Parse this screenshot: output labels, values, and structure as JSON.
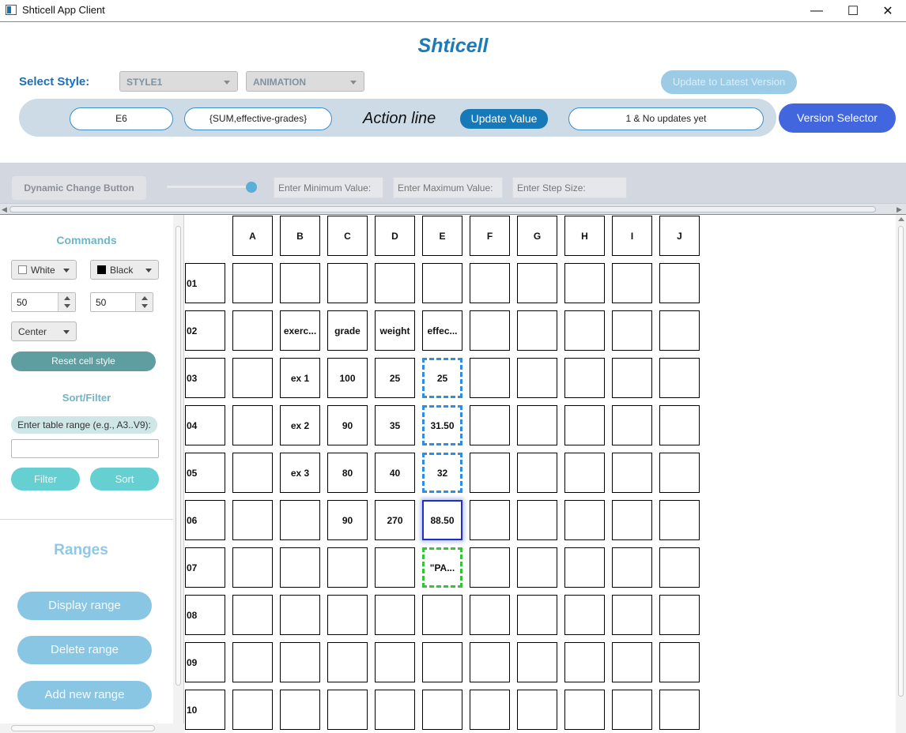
{
  "window": {
    "title": "Shticell App Client",
    "minimize_glyph": "—",
    "maximize_glyph": "☐",
    "close_glyph": "✕"
  },
  "header": {
    "brand": "Shticell",
    "select_style_label": "Select Style:",
    "style_combo": "STYLE1",
    "animation_combo": "ANIMATION",
    "update_latest_label": "Update to Latest Version"
  },
  "action_bar": {
    "cell_id": "E6",
    "original_value": "{SUM,effective-grades}",
    "label": "Action line",
    "update_value_label": "Update Value",
    "version_info": "1 & No updates yet",
    "version_selector_label": "Version Selector"
  },
  "dynamic": {
    "button_label": "Dynamic Change Button",
    "min_placeholder": "Enter Minimum Value:",
    "max_placeholder": "Enter Maximum Value:",
    "step_placeholder": "Enter Step Size:"
  },
  "commands": {
    "title": "Commands",
    "bg_color_label": "White",
    "text_color_label": "Black",
    "width_value": "50",
    "height_value": "50",
    "alignment_label": "Center",
    "reset_label": "Reset cell style"
  },
  "sort_filter": {
    "title": "Sort/Filter",
    "range_prompt": "Enter table range (e.g., A3..V9):",
    "range_value": "",
    "filter_label": "Filter",
    "sort_label": "Sort"
  },
  "ranges": {
    "title": "Ranges",
    "display_label": "Display range",
    "delete_label": "Delete range",
    "add_label": "Add new range"
  },
  "grid": {
    "columns": [
      "A",
      "B",
      "C",
      "D",
      "E",
      "F",
      "G",
      "H",
      "I",
      "J"
    ],
    "rows": [
      {
        "label": "01",
        "cells": [
          "",
          "",
          "",
          "",
          "",
          "",
          "",
          "",
          "",
          ""
        ]
      },
      {
        "label": "02",
        "cells": [
          "",
          "exerc...",
          "grade",
          "weight",
          "effec...",
          "",
          "",
          "",
          "",
          ""
        ]
      },
      {
        "label": "03",
        "cells": [
          "",
          "ex 1",
          "100",
          "25",
          "25",
          "",
          "",
          "",
          "",
          ""
        ]
      },
      {
        "label": "04",
        "cells": [
          "",
          "ex 2",
          "90",
          "35",
          "31.50",
          "",
          "",
          "",
          "",
          ""
        ]
      },
      {
        "label": "05",
        "cells": [
          "",
          "ex 3",
          "80",
          "40",
          "32",
          "",
          "",
          "",
          "",
          ""
        ]
      },
      {
        "label": "06",
        "cells": [
          "",
          "",
          "90",
          "270",
          "88.50",
          "",
          "",
          "",
          "",
          ""
        ]
      },
      {
        "label": "07",
        "cells": [
          "",
          "",
          "",
          "",
          "\"PA...",
          "",
          "",
          "",
          "",
          ""
        ]
      },
      {
        "label": "08",
        "cells": [
          "",
          "",
          "",
          "",
          "",
          "",
          "",
          "",
          "",
          ""
        ]
      },
      {
        "label": "09",
        "cells": [
          "",
          "",
          "",
          "",
          "",
          "",
          "",
          "",
          "",
          ""
        ]
      },
      {
        "label": "10",
        "cells": [
          "",
          "",
          "",
          "",
          "",
          "",
          "",
          "",
          "",
          ""
        ]
      }
    ],
    "selected_cell": "E6",
    "dependency_cells": [
      "E3",
      "E4",
      "E5"
    ],
    "influenced_cells": [
      "E7"
    ],
    "colors": {
      "dependency": "#2f8de4",
      "selected": "#1f2fbf",
      "influenced": "#33c43a"
    }
  }
}
